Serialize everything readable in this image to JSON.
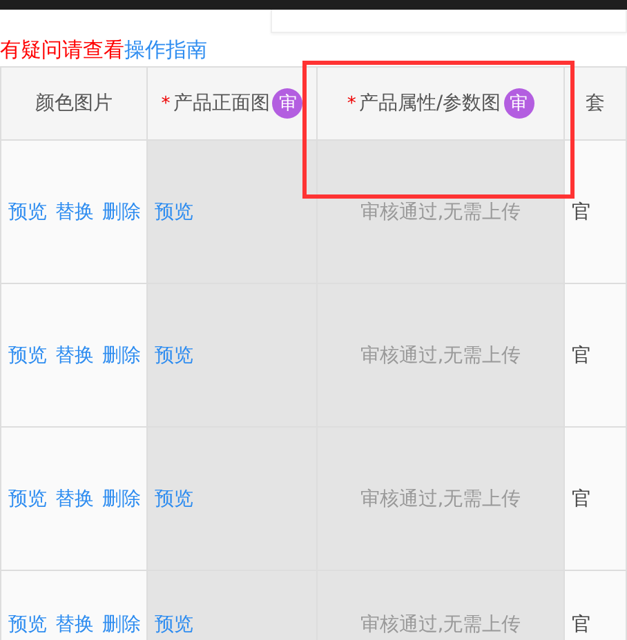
{
  "notice": {
    "text": "有疑问请查看",
    "link": "操作指南"
  },
  "columns": [
    {
      "label": "颜色图片",
      "highlighted": false
    },
    {
      "label": "产品正面图",
      "marker": "*",
      "badge": "审",
      "highlighted": false
    },
    {
      "label": "产品属性/参数图",
      "marker": "*",
      "badge": "审",
      "highlighted": true
    },
    {
      "label": "套",
      "highlighted": false
    }
  ],
  "rows": [
    {
      "actions": [
        "预览",
        "替换",
        "删除"
      ],
      "front": "预览",
      "attributes": "审核通过,无需上传",
      "package": "官"
    },
    {
      "actions": [
        "预览",
        "替换",
        "删除"
      ],
      "front": "预览",
      "attributes": "审核通过,无需上传",
      "package": "官"
    },
    {
      "actions": [
        "预览",
        "替换",
        "删除"
      ],
      "front": "预览",
      "attributes": "审核通过,无需上传",
      "package": "官"
    },
    {
      "actions": [
        "预览",
        "替换",
        "删除"
      ],
      "front": "预览",
      "attributes": "审核通过,无需上传",
      "package": "官"
    }
  ]
}
